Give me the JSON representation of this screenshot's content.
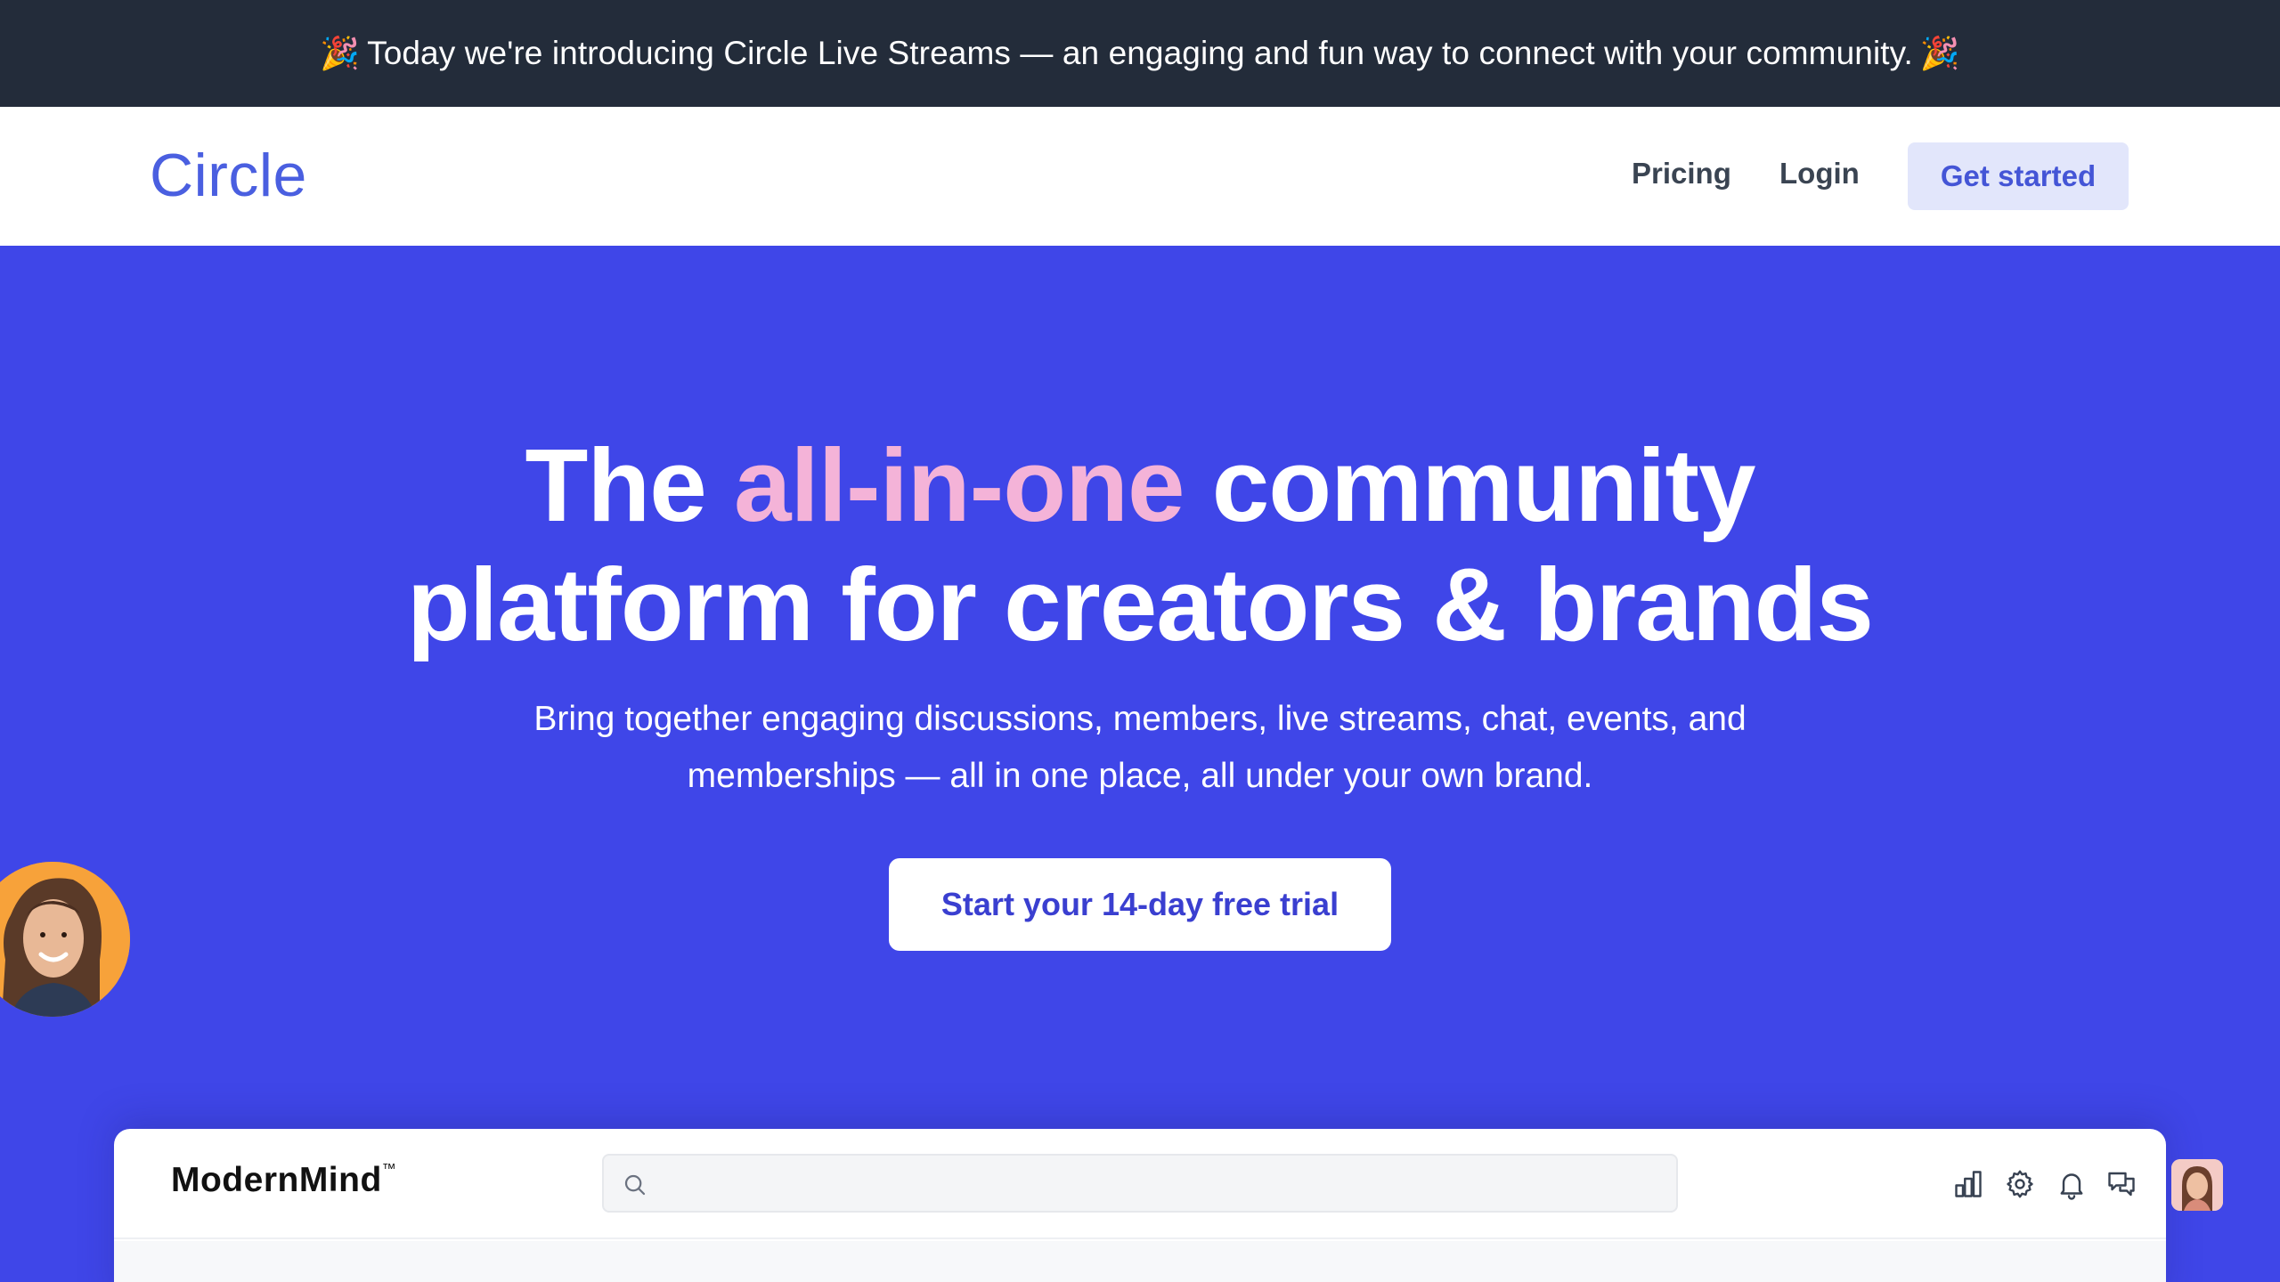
{
  "announcement": {
    "emoji": "🎉",
    "text": "Today we're introducing Circle Live Streams — an engaging and fun way to connect with your community."
  },
  "nav": {
    "logo": "Circle",
    "links": [
      "Pricing",
      "Login"
    ],
    "cta": "Get started"
  },
  "hero": {
    "title_pre": "The ",
    "title_accent": "all-in-one",
    "title_post_line1": " community",
    "title_line2": "platform for creators & brands",
    "subtitle_line1": "Bring together engaging discussions, members, live streams, chat, events, and",
    "subtitle_line2": "memberships — all in one place, all under your own brand.",
    "cta": "Start your 14-day free trial"
  },
  "preview": {
    "brand": "ModernMind",
    "brand_mark": "™",
    "search_placeholder": "",
    "icons": [
      "bar-chart-icon",
      "gear-icon",
      "bell-icon",
      "chat-bubbles-icon"
    ]
  },
  "colors": {
    "hero_bg": "#3f46e8",
    "announce_bg": "#232c3a",
    "accent_pink": "#f4b3d8",
    "logo_blue": "#4a5fe0"
  }
}
